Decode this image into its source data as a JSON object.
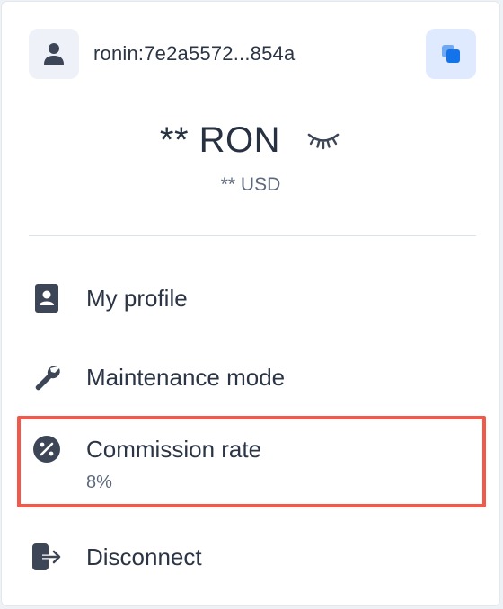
{
  "account": {
    "address": "ronin:7e2a5572...854a",
    "balance": "** RON",
    "balance_usd": "** USD"
  },
  "menu": {
    "items": [
      {
        "label": "My profile",
        "icon": "profile-card-icon"
      },
      {
        "label": "Maintenance mode",
        "icon": "wrench-icon"
      },
      {
        "label": "Commission rate",
        "value": "8%",
        "icon": "percent-icon"
      },
      {
        "label": "Disconnect",
        "icon": "logout-icon"
      }
    ]
  },
  "colors": {
    "accent": "#1273ea",
    "accent_bg": "#dfeaff",
    "icon": "#3d4656",
    "highlight": "#f2594a"
  }
}
